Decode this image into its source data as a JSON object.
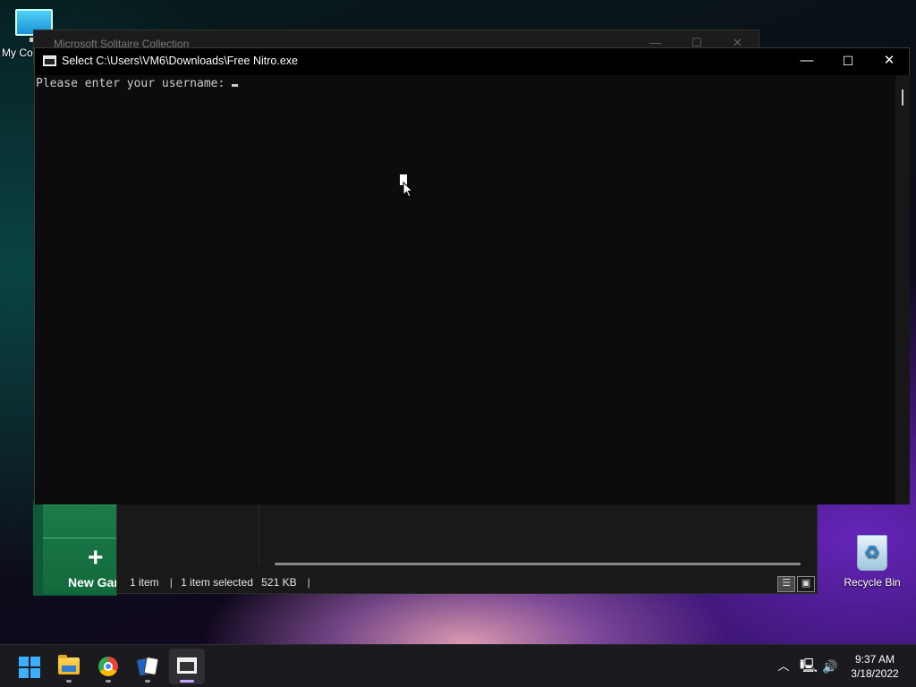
{
  "desktop": {
    "my_computer_label": "My Co",
    "recycle_bin_label": "Recycle Bin"
  },
  "background_window": {
    "title": "Microsoft Solitaire Collection",
    "new_game_label": "New Gar",
    "minimize_glyph": "—",
    "maximize_glyph": "☐",
    "close_glyph": "✕"
  },
  "explorer": {
    "item_count": "1 item",
    "selected_info": "1 item selected",
    "selected_size": "521 KB"
  },
  "console_window": {
    "title": "Select C:\\Users\\VM6\\Downloads\\Free Nitro.exe",
    "prompt_text": "Please enter your username: ",
    "minimize_glyph": "—",
    "maximize_glyph": "☐",
    "close_glyph": "✕"
  },
  "taskbar": {
    "apps": [
      {
        "name": "start",
        "icon": "windows-start-icon"
      },
      {
        "name": "file-explorer",
        "icon": "folder-icon"
      },
      {
        "name": "chrome",
        "icon": "chrome-icon"
      },
      {
        "name": "solitaire",
        "icon": "cards-icon"
      },
      {
        "name": "console",
        "icon": "terminal-icon",
        "active": true
      }
    ],
    "tray": {
      "chevron_glyph": "︿",
      "network_glyph": "🖳",
      "volume_glyph": "🔊"
    },
    "time": "9:37 AM",
    "date": "3/18/2022"
  },
  "colors": {
    "console_bg": "#0c0c0c",
    "console_text": "#cccccc",
    "taskbar_bg": "#1b1b1f",
    "active_indicator": "#c9a6ff"
  }
}
